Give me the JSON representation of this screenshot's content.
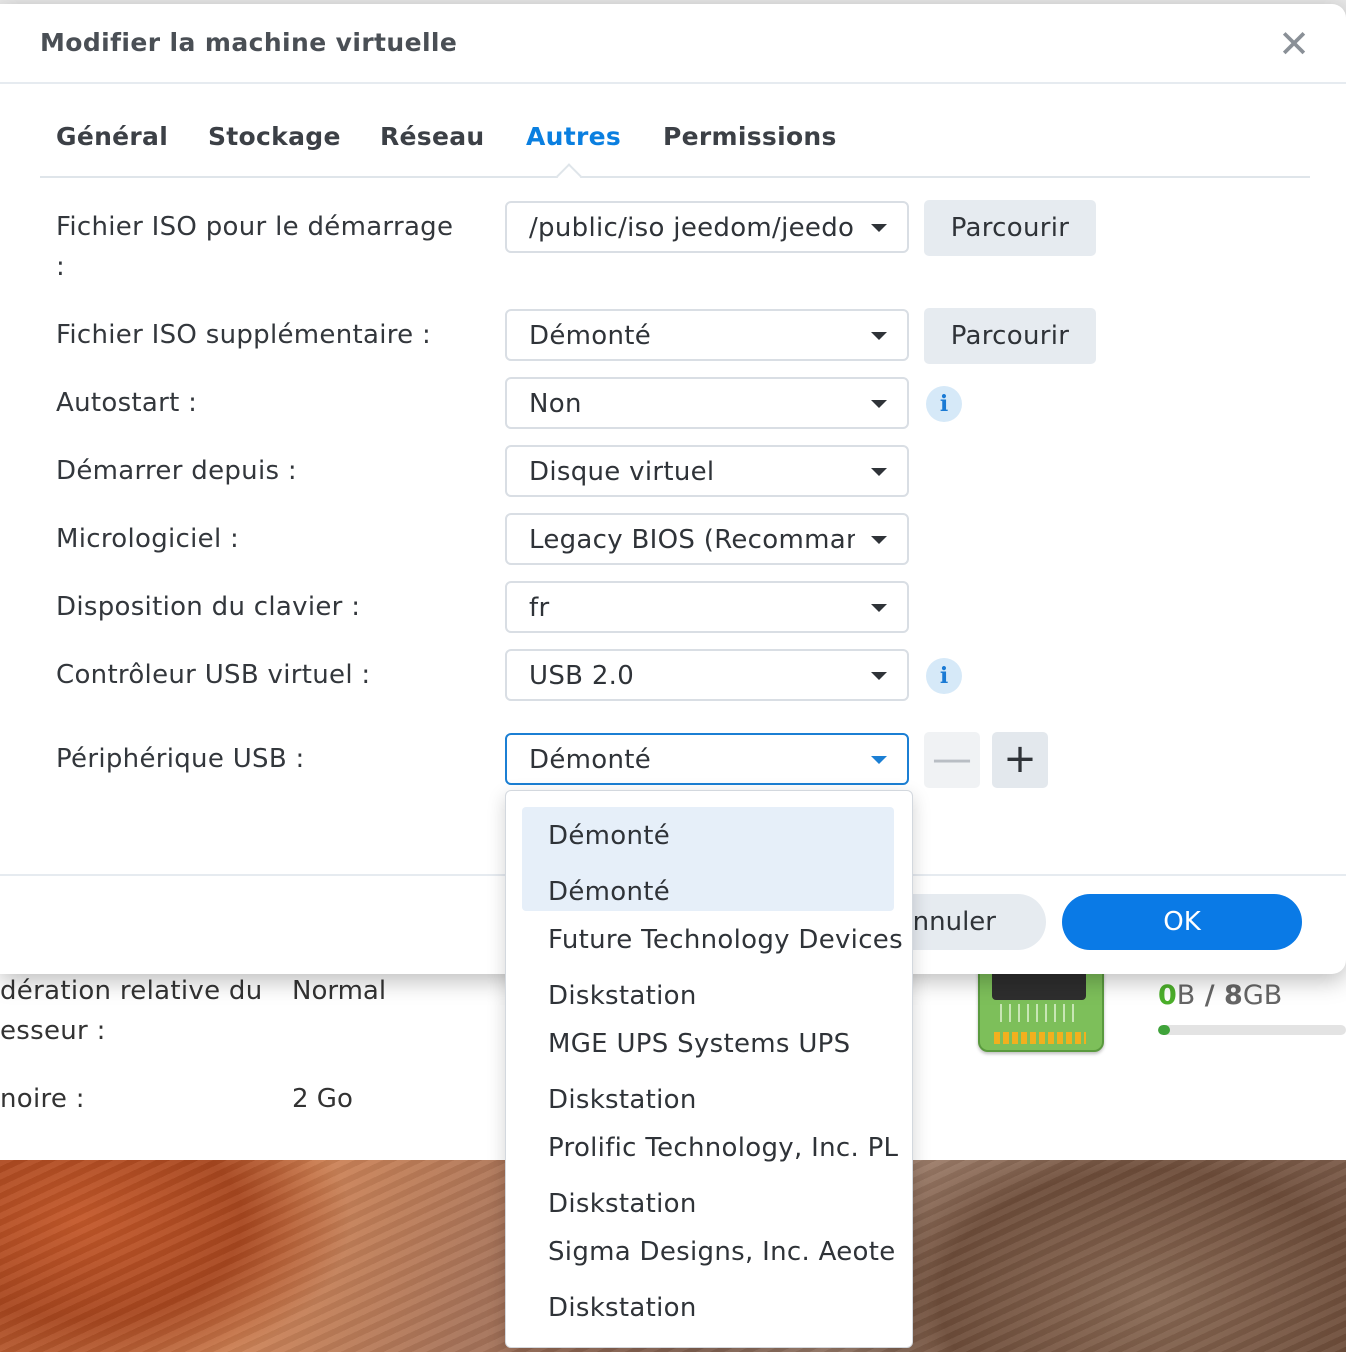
{
  "dialog": {
    "title": "Modifier la machine virtuelle",
    "close_glyph": "✕",
    "tabs": [
      {
        "label": "Général",
        "active": false
      },
      {
        "label": "Stockage",
        "active": false
      },
      {
        "label": "Réseau",
        "active": false
      },
      {
        "label": "Autres",
        "active": true
      },
      {
        "label": "Permissions",
        "active": false
      }
    ]
  },
  "form": {
    "boot_iso": {
      "label": "Fichier ISO pour le démarrage",
      "label_colon": ":",
      "value": "/public/iso jeedom/jeedom",
      "browse_label": "Parcourir"
    },
    "extra_iso": {
      "label": "Fichier ISO supplémentaire :",
      "value": "Démonté",
      "browse_label": "Parcourir"
    },
    "autostart": {
      "label": "Autostart :",
      "value": "Non",
      "info_glyph": "i"
    },
    "boot_from": {
      "label": "Démarrer depuis :",
      "value": "Disque virtuel"
    },
    "firmware": {
      "label": "Micrologiciel :",
      "value": "Legacy BIOS (Recommandé)"
    },
    "keyboard_layout": {
      "label": "Disposition du clavier :",
      "value": "fr"
    },
    "usb_controller": {
      "label": "Contrôleur USB virtuel :",
      "value": "USB 2.0",
      "info_glyph": "i"
    },
    "usb_device": {
      "label": "Périphérique USB :",
      "value": "Démonté",
      "minus_glyph": "—",
      "plus_glyph": "+"
    }
  },
  "usb_dropdown": {
    "options": [
      {
        "line1": "Démonté",
        "line2": "Démonté",
        "highlighted": true
      },
      {
        "line1": "Future Technology Devices",
        "line2": "Diskstation"
      },
      {
        "line1": "MGE UPS Systems UPS",
        "line2": "Diskstation"
      },
      {
        "line1": "Prolific Technology, Inc. PL",
        "line2": "Diskstation"
      },
      {
        "line1": "Sigma Designs, Inc. Aeote",
        "line2": "Diskstation"
      }
    ]
  },
  "footer": {
    "cancel_label": "Annuler",
    "ok_label": "OK"
  },
  "background": {
    "cpu_priority_label_line1": "dération relative du",
    "cpu_priority_label_line2": "esseur :",
    "cpu_priority_value": "Normal",
    "memory_label": "noire :",
    "memory_value": "2 Go",
    "memory_used_number": "0",
    "memory_used_unit": "B",
    "memory_separator": "/",
    "memory_total_number": "8",
    "memory_total_unit": "GB",
    "memory_usage_fraction": 0.0,
    "ram_icon": "ram-module-icon"
  },
  "colors": {
    "accent": "#0a7ae6",
    "active_tab": "#0a7fe0",
    "memory_used": "#4caf2b"
  }
}
